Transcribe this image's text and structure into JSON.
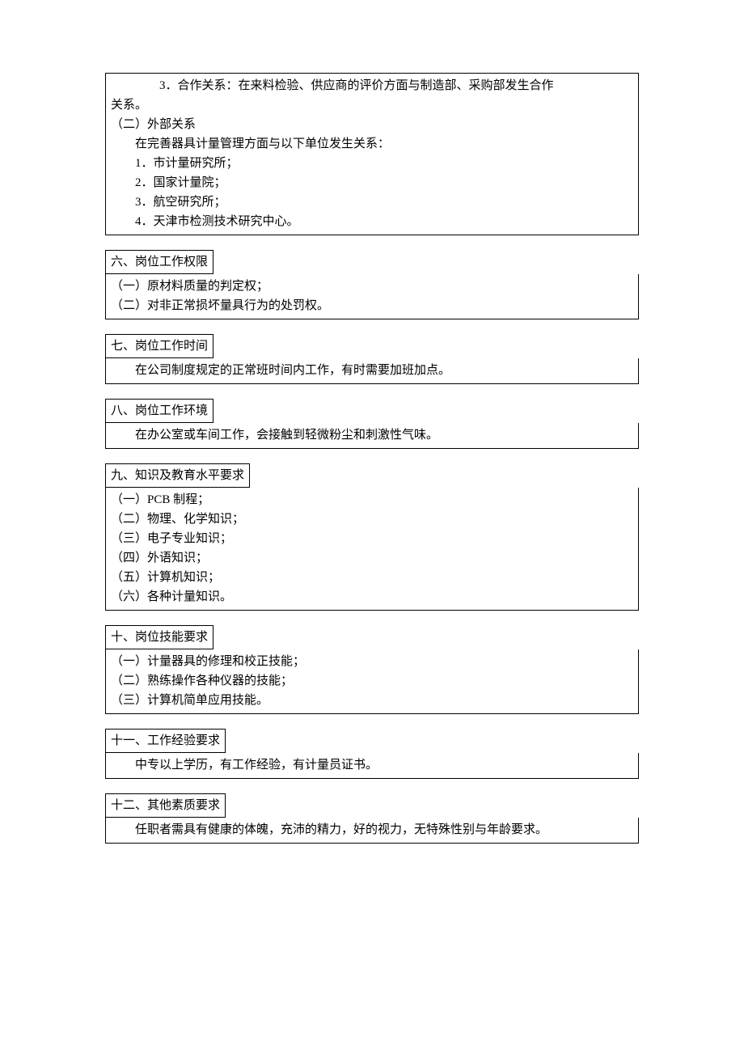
{
  "section5": {
    "lines": [
      {
        "cls": "indent-4",
        "text": "3．合作关系：在来料检验、供应商的评价方面与制造部、采购部发生合作"
      },
      {
        "cls": "indent-1",
        "text": "关系。"
      },
      {
        "cls": "indent-1",
        "text": "（二）外部关系"
      },
      {
        "cls": "indent-2",
        "text": "在完善器具计量管理方面与以下单位发生关系："
      },
      {
        "cls": "indent-2",
        "text": "1．市计量研究所；"
      },
      {
        "cls": "indent-2",
        "text": "2．国家计量院；"
      },
      {
        "cls": "indent-2",
        "text": "3．航空研究所；"
      },
      {
        "cls": "indent-2",
        "text": "4．天津市检测技术研究中心。"
      }
    ]
  },
  "section6": {
    "title": "六、岗位工作权限",
    "lines": [
      {
        "cls": "indent-1",
        "text": "（一）原材料质量的判定权；"
      },
      {
        "cls": "indent-1",
        "text": "（二）对非正常损坏量具行为的处罚权。"
      }
    ]
  },
  "section7": {
    "title": "七、岗位工作时间",
    "lines": [
      {
        "cls": "indent-2",
        "text": "在公司制度规定的正常班时间内工作，有时需要加班加点。"
      }
    ]
  },
  "section8": {
    "title": "八、岗位工作环境",
    "lines": [
      {
        "cls": "indent-2",
        "text": "在办公室或车间工作，会接触到轻微粉尘和刺激性气味。"
      }
    ]
  },
  "section9": {
    "title": "九、知识及教育水平要求",
    "lines": [
      {
        "cls": "indent-1",
        "text": "（一）PCB 制程；"
      },
      {
        "cls": "indent-1",
        "text": "（二）物理、化学知识；"
      },
      {
        "cls": "indent-1",
        "text": "（三）电子专业知识；"
      },
      {
        "cls": "indent-1",
        "text": "（四）外语知识；"
      },
      {
        "cls": "indent-1",
        "text": "（五）计算机知识；"
      },
      {
        "cls": "indent-1",
        "text": "（六）各种计量知识。"
      }
    ]
  },
  "section10": {
    "title": "十、岗位技能要求",
    "lines": [
      {
        "cls": "indent-1",
        "text": "（一）计量器具的修理和校正技能；"
      },
      {
        "cls": "indent-1",
        "text": "（二）熟练操作各种仪器的技能；"
      },
      {
        "cls": "indent-1",
        "text": "（三）计算机简单应用技能。"
      }
    ]
  },
  "section11": {
    "title": "十一、工作经验要求",
    "lines": [
      {
        "cls": "indent-2",
        "text": "中专以上学历，有工作经验，有计量员证书。"
      }
    ]
  },
  "section12": {
    "title": "十二、其他素质要求",
    "lines": [
      {
        "cls": "indent-2",
        "text": "任职者需具有健康的体魄，充沛的精力，好的视力，无特殊性别与年龄要求。"
      }
    ]
  }
}
